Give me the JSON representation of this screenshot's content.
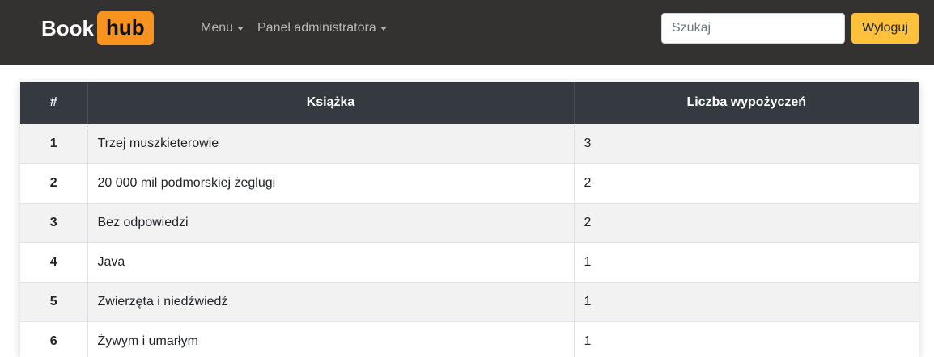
{
  "brand": {
    "part1": "Book",
    "part2": "hub"
  },
  "nav": {
    "menu_label": "Menu",
    "admin_label": "Panel administratora"
  },
  "search": {
    "placeholder": "Szukaj",
    "value": ""
  },
  "logout_label": "Wyloguj",
  "table": {
    "headers": [
      "#",
      "Książka",
      "Liczba wypożyczeń"
    ],
    "rows": [
      {
        "num": "1",
        "title": "Trzej muszkieterowie",
        "count": "3"
      },
      {
        "num": "2",
        "title": "20 000 mil podmorskiej żeglugi",
        "count": "2"
      },
      {
        "num": "3",
        "title": "Bez odpowiedzi",
        "count": "2"
      },
      {
        "num": "4",
        "title": "Java",
        "count": "1"
      },
      {
        "num": "5",
        "title": "Zwierzęta i niedźwiedź",
        "count": "1"
      },
      {
        "num": "6",
        "title": "Żywym i umarłym",
        "count": "1"
      }
    ]
  },
  "colors": {
    "navbar_bg": "#343131",
    "brand_accent": "#f7931e",
    "logout_bg": "#ffc13b",
    "table_header_bg": "#343a40",
    "stripe_bg": "#f2f2f2"
  }
}
